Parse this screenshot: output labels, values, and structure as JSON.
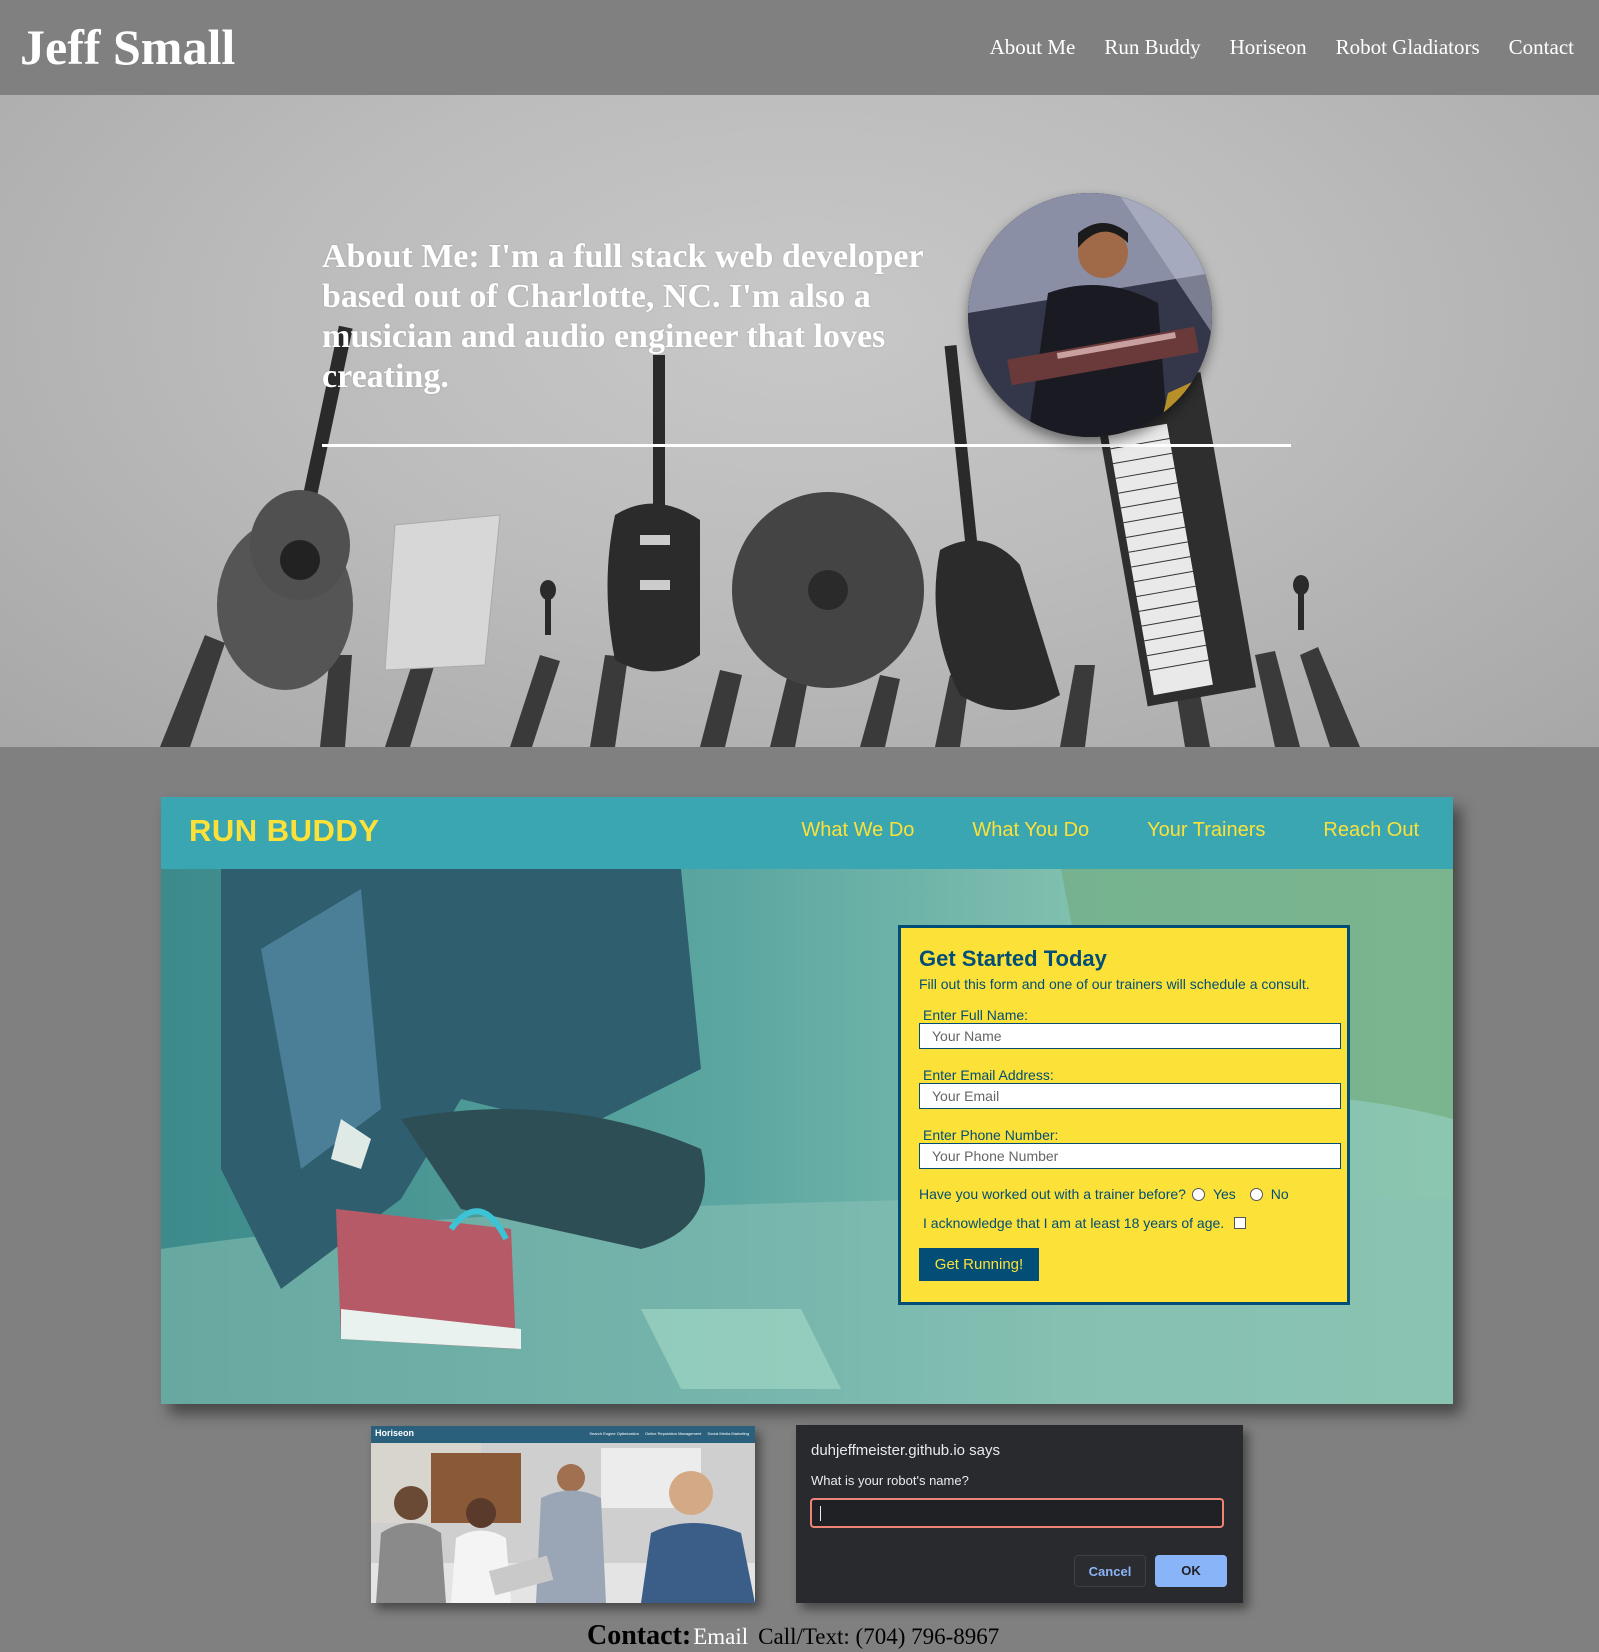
{
  "site": {
    "brand": "Jeff Small",
    "nav": [
      "About Me",
      "Run Buddy",
      "Horiseon",
      "Robot Gladiators",
      "Contact"
    ]
  },
  "hero": {
    "about_text": "About Me: I'm a full stack web developer based out of Charlotte, NC. I'm also a musician and audio engineer that loves creating."
  },
  "run_buddy": {
    "logo": "RUN BUDDY",
    "nav": [
      "What We Do",
      "What You Do",
      "Your Trainers",
      "Reach Out"
    ],
    "form": {
      "title": "Get Started Today",
      "subtitle": "Fill out this form and one of our trainers will schedule a consult.",
      "name_label": "Enter Full Name:",
      "name_placeholder": "Your Name",
      "email_label": "Enter Email Address:",
      "email_placeholder": "Your Email",
      "phone_label": "Enter Phone Number:",
      "phone_placeholder": "Your Phone Number",
      "trainer_question": "Have you worked out with a trainer before?",
      "yes_label": "Yes",
      "no_label": "No",
      "age_ack": "I acknowledge that I am at least 18 years of age.",
      "submit_label": "Get Running!"
    },
    "colors": {
      "header": "#39a6b2",
      "accent": "#fce138",
      "dark": "#024e76"
    }
  },
  "horiseon": {
    "logo": "Horiseon",
    "nav": [
      "Search Engine Optimization",
      "Online Reputation Management",
      "Social Media Marketing"
    ]
  },
  "robot_dialog": {
    "title": "duhjeffmeister.github.io says",
    "message": "What is your robot's name?",
    "input_value": "",
    "cancel_label": "Cancel",
    "ok_label": "OK"
  },
  "contact": {
    "label": "Contact:",
    "email_label": "Email",
    "phone_text": "Call/Text: (704) 796-8967"
  }
}
